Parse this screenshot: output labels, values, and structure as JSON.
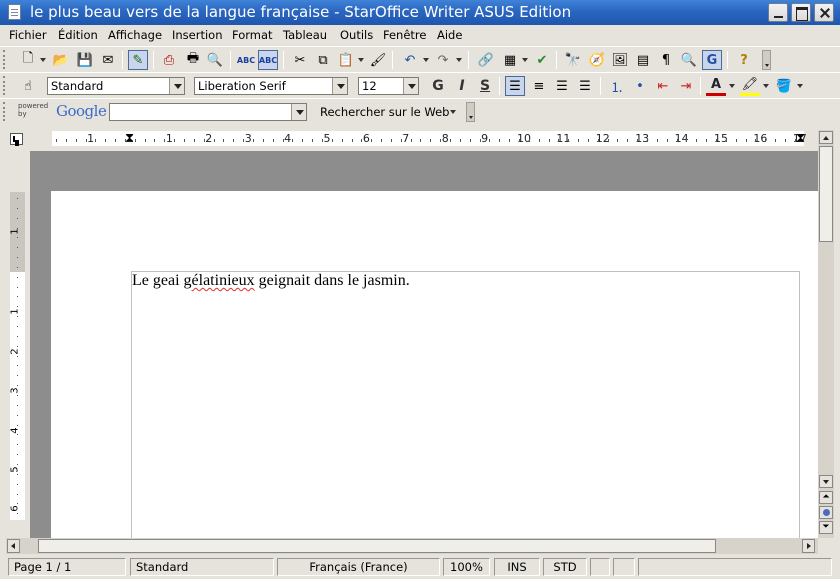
{
  "window": {
    "title": "le plus beau vers de la langue française - StarOffice Writer ASUS Edition"
  },
  "menubar": [
    "Fichier",
    "Édition",
    "Affichage",
    "Insertion",
    "Format",
    "Tableau",
    "Outils",
    "Fenêtre",
    "Aide"
  ],
  "formatting": {
    "paragraph_style": "Standard",
    "font_name": "Liberation Serif",
    "font_size": "12",
    "bold_label": "G",
    "italic_label": "I",
    "underline_label": "S"
  },
  "search_toolbar": {
    "powered_by": "powered by",
    "brand": "Google",
    "query": "",
    "search_button": "Rechercher sur le Web"
  },
  "ruler": {
    "h_numbers": [
      "1",
      "1",
      "2",
      "3",
      "4",
      "5",
      "6",
      "7",
      "8",
      "9",
      "10",
      "11",
      "12",
      "13",
      "14",
      "15",
      "16",
      "17"
    ],
    "v_numbers": [
      "1",
      "1",
      "2",
      "3",
      "4",
      "5",
      "6"
    ]
  },
  "document": {
    "text_before": "Le geai ",
    "misspelled_word": "gélatinieux",
    "text_after": " geignait dans le jasmin."
  },
  "status": {
    "page": "Page 1 / 1",
    "page_style": "Standard",
    "language": "Français (France)",
    "zoom": "100%",
    "insert_mode": "INS",
    "selection_mode": "STD"
  },
  "colors": {
    "titlebar": "#2a66c0",
    "font_color_swatch": "#cc0000",
    "highlight_swatch": "#ffff00",
    "spellcheck_underline": "#e03030"
  }
}
